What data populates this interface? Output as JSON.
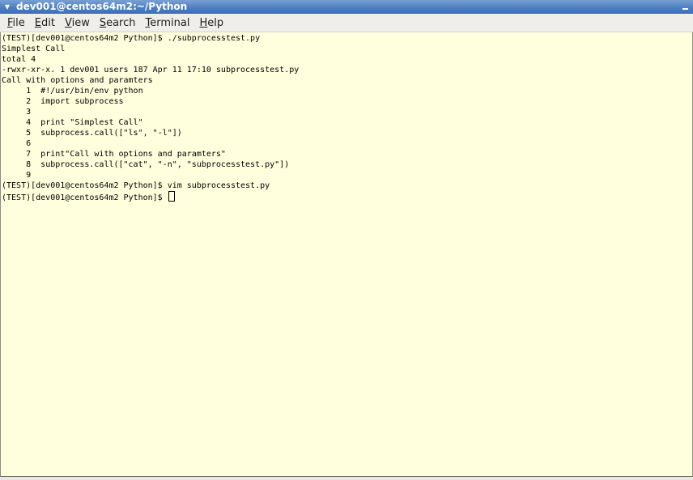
{
  "window": {
    "title": "dev001@centos64m2:~/Python"
  },
  "menubar": {
    "items": [
      {
        "accel": "F",
        "rest": "ile"
      },
      {
        "accel": "E",
        "rest": "dit"
      },
      {
        "accel": "V",
        "rest": "iew"
      },
      {
        "accel": "S",
        "rest": "earch"
      },
      {
        "accel": "T",
        "rest": "erminal"
      },
      {
        "accel": "H",
        "rest": "elp"
      }
    ]
  },
  "terminal": {
    "lines": [
      "(TEST)[dev001@centos64m2 Python]$ ./subprocesstest.py",
      "Simplest Call",
      "total 4",
      "-rwxr-xr-x. 1 dev001 users 187 Apr 11 17:10 subprocesstest.py",
      "Call with options and paramters",
      "     1\t#!/usr/bin/env python",
      "     2\timport subprocess",
      "     3\t",
      "     4\tprint \"Simplest Call\"",
      "     5\tsubprocess.call([\"ls\", \"-l\"])",
      "     6\t",
      "     7\tprint\"Call with options and paramters\"",
      "     8\tsubprocess.call([\"cat\", \"-n\", \"subprocesstest.py\"])",
      "     9\t",
      "(TEST)[dev001@centos64m2 Python]$ vim subprocesstest.py"
    ],
    "prompt": "(TEST)[dev001@centos64m2 Python]$ "
  }
}
